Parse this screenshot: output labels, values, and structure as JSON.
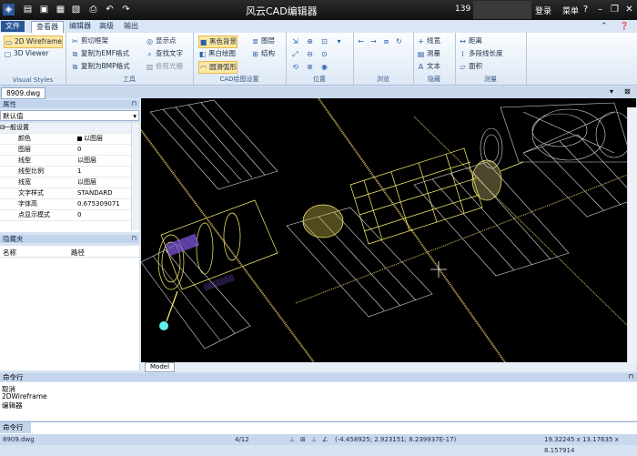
{
  "title_bar": {
    "title": "风云CAD编辑器",
    "user_id": "139",
    "login": "登录",
    "menu": "菜单",
    "window_controls": [
      "help-icon",
      "minimize-icon",
      "restore-icon",
      "close-icon"
    ]
  },
  "tabs": [
    {
      "label": "文件"
    },
    {
      "label": "查看器"
    },
    {
      "label": "编辑器"
    },
    {
      "label": "高级"
    },
    {
      "label": "输出"
    }
  ],
  "ribbon": {
    "visual_styles": {
      "label": "Visual Styles",
      "wireframe2d": "2D Wireframe",
      "viewer3d": "3D Viewer"
    },
    "tools": {
      "label": "工具",
      "clip": "剪切框架",
      "copy_emf": "复制为EMF格式",
      "copy_bmp": "复制为BMP格式",
      "show_point": "显示点",
      "find_text": "查找文字",
      "trim_raster": "修剪光栅"
    },
    "cad_settings": {
      "label": "CAD绘图设置",
      "black_bg": "黑色背景",
      "black_white": "黑白绘图",
      "smooth_arc": "圆滑弧形",
      "layers": "图层",
      "structure": "结构"
    },
    "position": {
      "label": "位置"
    },
    "browse": {
      "label": "浏览"
    },
    "hide": {
      "label": "隐藏",
      "lineweight": "线宽",
      "measure": "测量",
      "text": "文本"
    },
    "measure": {
      "label": "测量",
      "distance": "距离",
      "polyline_length": "多段线长度",
      "area": "面积"
    }
  },
  "doc_tab": "8909.dwg",
  "properties_panel": {
    "title": "属性",
    "selector": "默认值",
    "rows": [
      {
        "key": "一般设置",
        "value": "",
        "group": true
      },
      {
        "key": "颜色",
        "value": "以图层"
      },
      {
        "key": "图层",
        "value": "0"
      },
      {
        "key": "线型",
        "value": "以图层"
      },
      {
        "key": "线型比例",
        "value": "1"
      },
      {
        "key": "线宽",
        "value": "以图层"
      },
      {
        "key": "文字样式",
        "value": "STANDARD"
      },
      {
        "key": "字体高",
        "value": "0.675309071"
      },
      {
        "key": "点显示模式",
        "value": "0"
      }
    ]
  },
  "layers_panel": {
    "title": "隐藏夹",
    "columns": [
      "名称",
      "路径"
    ]
  },
  "canvas": {
    "model_tab": "Model",
    "colors": {
      "background": "#000000",
      "wire": "#fff36b",
      "frame": "#d8d8d8",
      "label": "#7b55d6",
      "cyan": "#5ff0e8"
    }
  },
  "command": {
    "title": "命令行",
    "history": [
      "取消",
      "2DWireframe",
      "编辑器"
    ],
    "input_label": "命令行",
    "input_value": ""
  },
  "status_bar": {
    "file": "8909.dwg",
    "pages": "4/12",
    "coords": "(-4.458925; 2.923151; 8.239937E-17)",
    "size": "19.32245 x 13.17635 x 8.157914"
  }
}
